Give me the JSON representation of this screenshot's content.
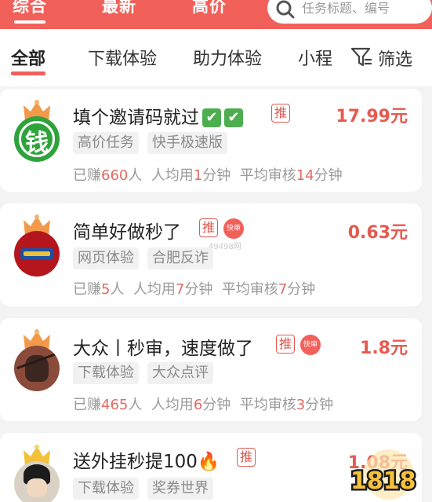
{
  "sort_tabs": [
    "综合",
    "最新",
    "高价"
  ],
  "search": {
    "placeholder": "任务标题、编号"
  },
  "categories": [
    "全部",
    "下载体验",
    "助力体验",
    "小程"
  ],
  "filter_label": "筛选",
  "colors": {
    "accent": "#f2605a",
    "reward": "#e55a50",
    "highlight": "#e06b63"
  },
  "tasks": [
    {
      "title": "填个邀请码就过",
      "title_icons": [
        "check-mark-icon",
        "check-mark-icon"
      ],
      "badge": "推",
      "reward": "17.99元",
      "tags": [
        "高价任务",
        "快手极速版"
      ],
      "avatar_text": "钱",
      "stats": {
        "earned_prefix": "已赚",
        "earned": "660",
        "earned_suffix": "人",
        "avg_prefix": "人均用",
        "avg": "1",
        "avg_suffix": "分钟",
        "review_prefix": "平均审核",
        "review": "14",
        "review_suffix": "分钟"
      }
    },
    {
      "title": "简单好做秒了",
      "badge": "推",
      "fast_badge": "快审",
      "reward": "0.63元",
      "tags": [
        "网页体验",
        "合肥反诈"
      ],
      "watermark": "49498网",
      "stats": {
        "earned_prefix": "已赚",
        "earned": "5",
        "earned_suffix": "人",
        "avg_prefix": "人均用",
        "avg": "7",
        "avg_suffix": "分钟",
        "review_prefix": "平均审核",
        "review": "7",
        "review_suffix": "分钟"
      }
    },
    {
      "title": "大众丨秒审，速度做了",
      "badge": "推",
      "fast_badge": "快审",
      "reward": "1.8元",
      "tags": [
        "下载体验",
        "大众点评"
      ],
      "stats": {
        "earned_prefix": "已赚",
        "earned": "465",
        "earned_suffix": "人",
        "avg_prefix": "人均用",
        "avg": "6",
        "avg_suffix": "分钟",
        "review_prefix": "平均审核",
        "review": "3",
        "review_suffix": "分钟"
      }
    },
    {
      "title": "送外挂秒提100",
      "title_icons": [
        "fire-icon"
      ],
      "badge": "推",
      "reward": "1.08元",
      "tags": [
        "下载体验",
        "奖券世界"
      ]
    }
  ]
}
